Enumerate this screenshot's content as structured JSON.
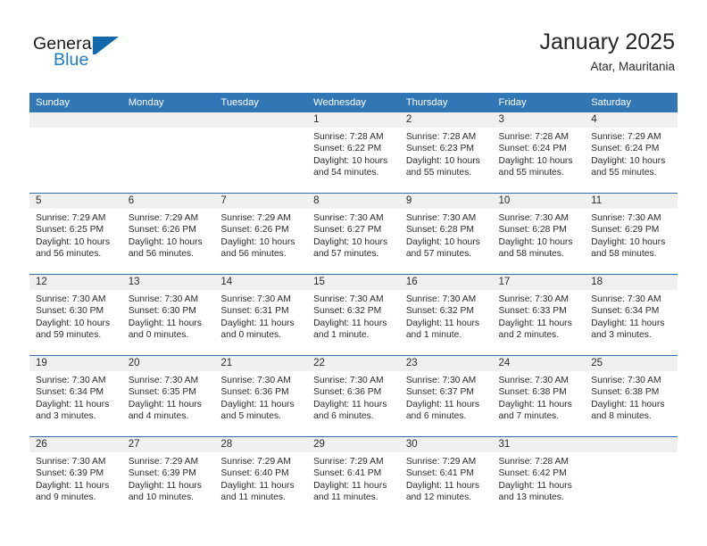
{
  "brand": {
    "name_part1": "General",
    "name_part2": "Blue",
    "logo_icon": "triangle-flag-icon",
    "accent_color": "#1f7bc1"
  },
  "header": {
    "title": "January 2025",
    "subtitle": "Atar, Mauritania"
  },
  "colors": {
    "header_blue": "#3176b5",
    "week_divider": "#2f6ea8",
    "daynum_band": "#f0f0f0",
    "text": "#2b2b2b"
  },
  "weekday_headers": [
    "Sunday",
    "Monday",
    "Tuesday",
    "Wednesday",
    "Thursday",
    "Friday",
    "Saturday"
  ],
  "weeks": [
    [
      {
        "day": "",
        "sunrise": "",
        "sunset": "",
        "daylight1": "",
        "daylight2": ""
      },
      {
        "day": "",
        "sunrise": "",
        "sunset": "",
        "daylight1": "",
        "daylight2": ""
      },
      {
        "day": "",
        "sunrise": "",
        "sunset": "",
        "daylight1": "",
        "daylight2": ""
      },
      {
        "day": "1",
        "sunrise": "Sunrise: 7:28 AM",
        "sunset": "Sunset: 6:22 PM",
        "daylight1": "Daylight: 10 hours",
        "daylight2": "and 54 minutes."
      },
      {
        "day": "2",
        "sunrise": "Sunrise: 7:28 AM",
        "sunset": "Sunset: 6:23 PM",
        "daylight1": "Daylight: 10 hours",
        "daylight2": "and 55 minutes."
      },
      {
        "day": "3",
        "sunrise": "Sunrise: 7:28 AM",
        "sunset": "Sunset: 6:24 PM",
        "daylight1": "Daylight: 10 hours",
        "daylight2": "and 55 minutes."
      },
      {
        "day": "4",
        "sunrise": "Sunrise: 7:29 AM",
        "sunset": "Sunset: 6:24 PM",
        "daylight1": "Daylight: 10 hours",
        "daylight2": "and 55 minutes."
      }
    ],
    [
      {
        "day": "5",
        "sunrise": "Sunrise: 7:29 AM",
        "sunset": "Sunset: 6:25 PM",
        "daylight1": "Daylight: 10 hours",
        "daylight2": "and 56 minutes."
      },
      {
        "day": "6",
        "sunrise": "Sunrise: 7:29 AM",
        "sunset": "Sunset: 6:26 PM",
        "daylight1": "Daylight: 10 hours",
        "daylight2": "and 56 minutes."
      },
      {
        "day": "7",
        "sunrise": "Sunrise: 7:29 AM",
        "sunset": "Sunset: 6:26 PM",
        "daylight1": "Daylight: 10 hours",
        "daylight2": "and 56 minutes."
      },
      {
        "day": "8",
        "sunrise": "Sunrise: 7:30 AM",
        "sunset": "Sunset: 6:27 PM",
        "daylight1": "Daylight: 10 hours",
        "daylight2": "and 57 minutes."
      },
      {
        "day": "9",
        "sunrise": "Sunrise: 7:30 AM",
        "sunset": "Sunset: 6:28 PM",
        "daylight1": "Daylight: 10 hours",
        "daylight2": "and 57 minutes."
      },
      {
        "day": "10",
        "sunrise": "Sunrise: 7:30 AM",
        "sunset": "Sunset: 6:28 PM",
        "daylight1": "Daylight: 10 hours",
        "daylight2": "and 58 minutes."
      },
      {
        "day": "11",
        "sunrise": "Sunrise: 7:30 AM",
        "sunset": "Sunset: 6:29 PM",
        "daylight1": "Daylight: 10 hours",
        "daylight2": "and 58 minutes."
      }
    ],
    [
      {
        "day": "12",
        "sunrise": "Sunrise: 7:30 AM",
        "sunset": "Sunset: 6:30 PM",
        "daylight1": "Daylight: 10 hours",
        "daylight2": "and 59 minutes."
      },
      {
        "day": "13",
        "sunrise": "Sunrise: 7:30 AM",
        "sunset": "Sunset: 6:30 PM",
        "daylight1": "Daylight: 11 hours",
        "daylight2": "and 0 minutes."
      },
      {
        "day": "14",
        "sunrise": "Sunrise: 7:30 AM",
        "sunset": "Sunset: 6:31 PM",
        "daylight1": "Daylight: 11 hours",
        "daylight2": "and 0 minutes."
      },
      {
        "day": "15",
        "sunrise": "Sunrise: 7:30 AM",
        "sunset": "Sunset: 6:32 PM",
        "daylight1": "Daylight: 11 hours",
        "daylight2": "and 1 minute."
      },
      {
        "day": "16",
        "sunrise": "Sunrise: 7:30 AM",
        "sunset": "Sunset: 6:32 PM",
        "daylight1": "Daylight: 11 hours",
        "daylight2": "and 1 minute."
      },
      {
        "day": "17",
        "sunrise": "Sunrise: 7:30 AM",
        "sunset": "Sunset: 6:33 PM",
        "daylight1": "Daylight: 11 hours",
        "daylight2": "and 2 minutes."
      },
      {
        "day": "18",
        "sunrise": "Sunrise: 7:30 AM",
        "sunset": "Sunset: 6:34 PM",
        "daylight1": "Daylight: 11 hours",
        "daylight2": "and 3 minutes."
      }
    ],
    [
      {
        "day": "19",
        "sunrise": "Sunrise: 7:30 AM",
        "sunset": "Sunset: 6:34 PM",
        "daylight1": "Daylight: 11 hours",
        "daylight2": "and 3 minutes."
      },
      {
        "day": "20",
        "sunrise": "Sunrise: 7:30 AM",
        "sunset": "Sunset: 6:35 PM",
        "daylight1": "Daylight: 11 hours",
        "daylight2": "and 4 minutes."
      },
      {
        "day": "21",
        "sunrise": "Sunrise: 7:30 AM",
        "sunset": "Sunset: 6:36 PM",
        "daylight1": "Daylight: 11 hours",
        "daylight2": "and 5 minutes."
      },
      {
        "day": "22",
        "sunrise": "Sunrise: 7:30 AM",
        "sunset": "Sunset: 6:36 PM",
        "daylight1": "Daylight: 11 hours",
        "daylight2": "and 6 minutes."
      },
      {
        "day": "23",
        "sunrise": "Sunrise: 7:30 AM",
        "sunset": "Sunset: 6:37 PM",
        "daylight1": "Daylight: 11 hours",
        "daylight2": "and 6 minutes."
      },
      {
        "day": "24",
        "sunrise": "Sunrise: 7:30 AM",
        "sunset": "Sunset: 6:38 PM",
        "daylight1": "Daylight: 11 hours",
        "daylight2": "and 7 minutes."
      },
      {
        "day": "25",
        "sunrise": "Sunrise: 7:30 AM",
        "sunset": "Sunset: 6:38 PM",
        "daylight1": "Daylight: 11 hours",
        "daylight2": "and 8 minutes."
      }
    ],
    [
      {
        "day": "26",
        "sunrise": "Sunrise: 7:30 AM",
        "sunset": "Sunset: 6:39 PM",
        "daylight1": "Daylight: 11 hours",
        "daylight2": "and 9 minutes."
      },
      {
        "day": "27",
        "sunrise": "Sunrise: 7:29 AM",
        "sunset": "Sunset: 6:39 PM",
        "daylight1": "Daylight: 11 hours",
        "daylight2": "and 10 minutes."
      },
      {
        "day": "28",
        "sunrise": "Sunrise: 7:29 AM",
        "sunset": "Sunset: 6:40 PM",
        "daylight1": "Daylight: 11 hours",
        "daylight2": "and 11 minutes."
      },
      {
        "day": "29",
        "sunrise": "Sunrise: 7:29 AM",
        "sunset": "Sunset: 6:41 PM",
        "daylight1": "Daylight: 11 hours",
        "daylight2": "and 11 minutes."
      },
      {
        "day": "30",
        "sunrise": "Sunrise: 7:29 AM",
        "sunset": "Sunset: 6:41 PM",
        "daylight1": "Daylight: 11 hours",
        "daylight2": "and 12 minutes."
      },
      {
        "day": "31",
        "sunrise": "Sunrise: 7:28 AM",
        "sunset": "Sunset: 6:42 PM",
        "daylight1": "Daylight: 11 hours",
        "daylight2": "and 13 minutes."
      },
      {
        "day": "",
        "sunrise": "",
        "sunset": "",
        "daylight1": "",
        "daylight2": ""
      }
    ]
  ]
}
